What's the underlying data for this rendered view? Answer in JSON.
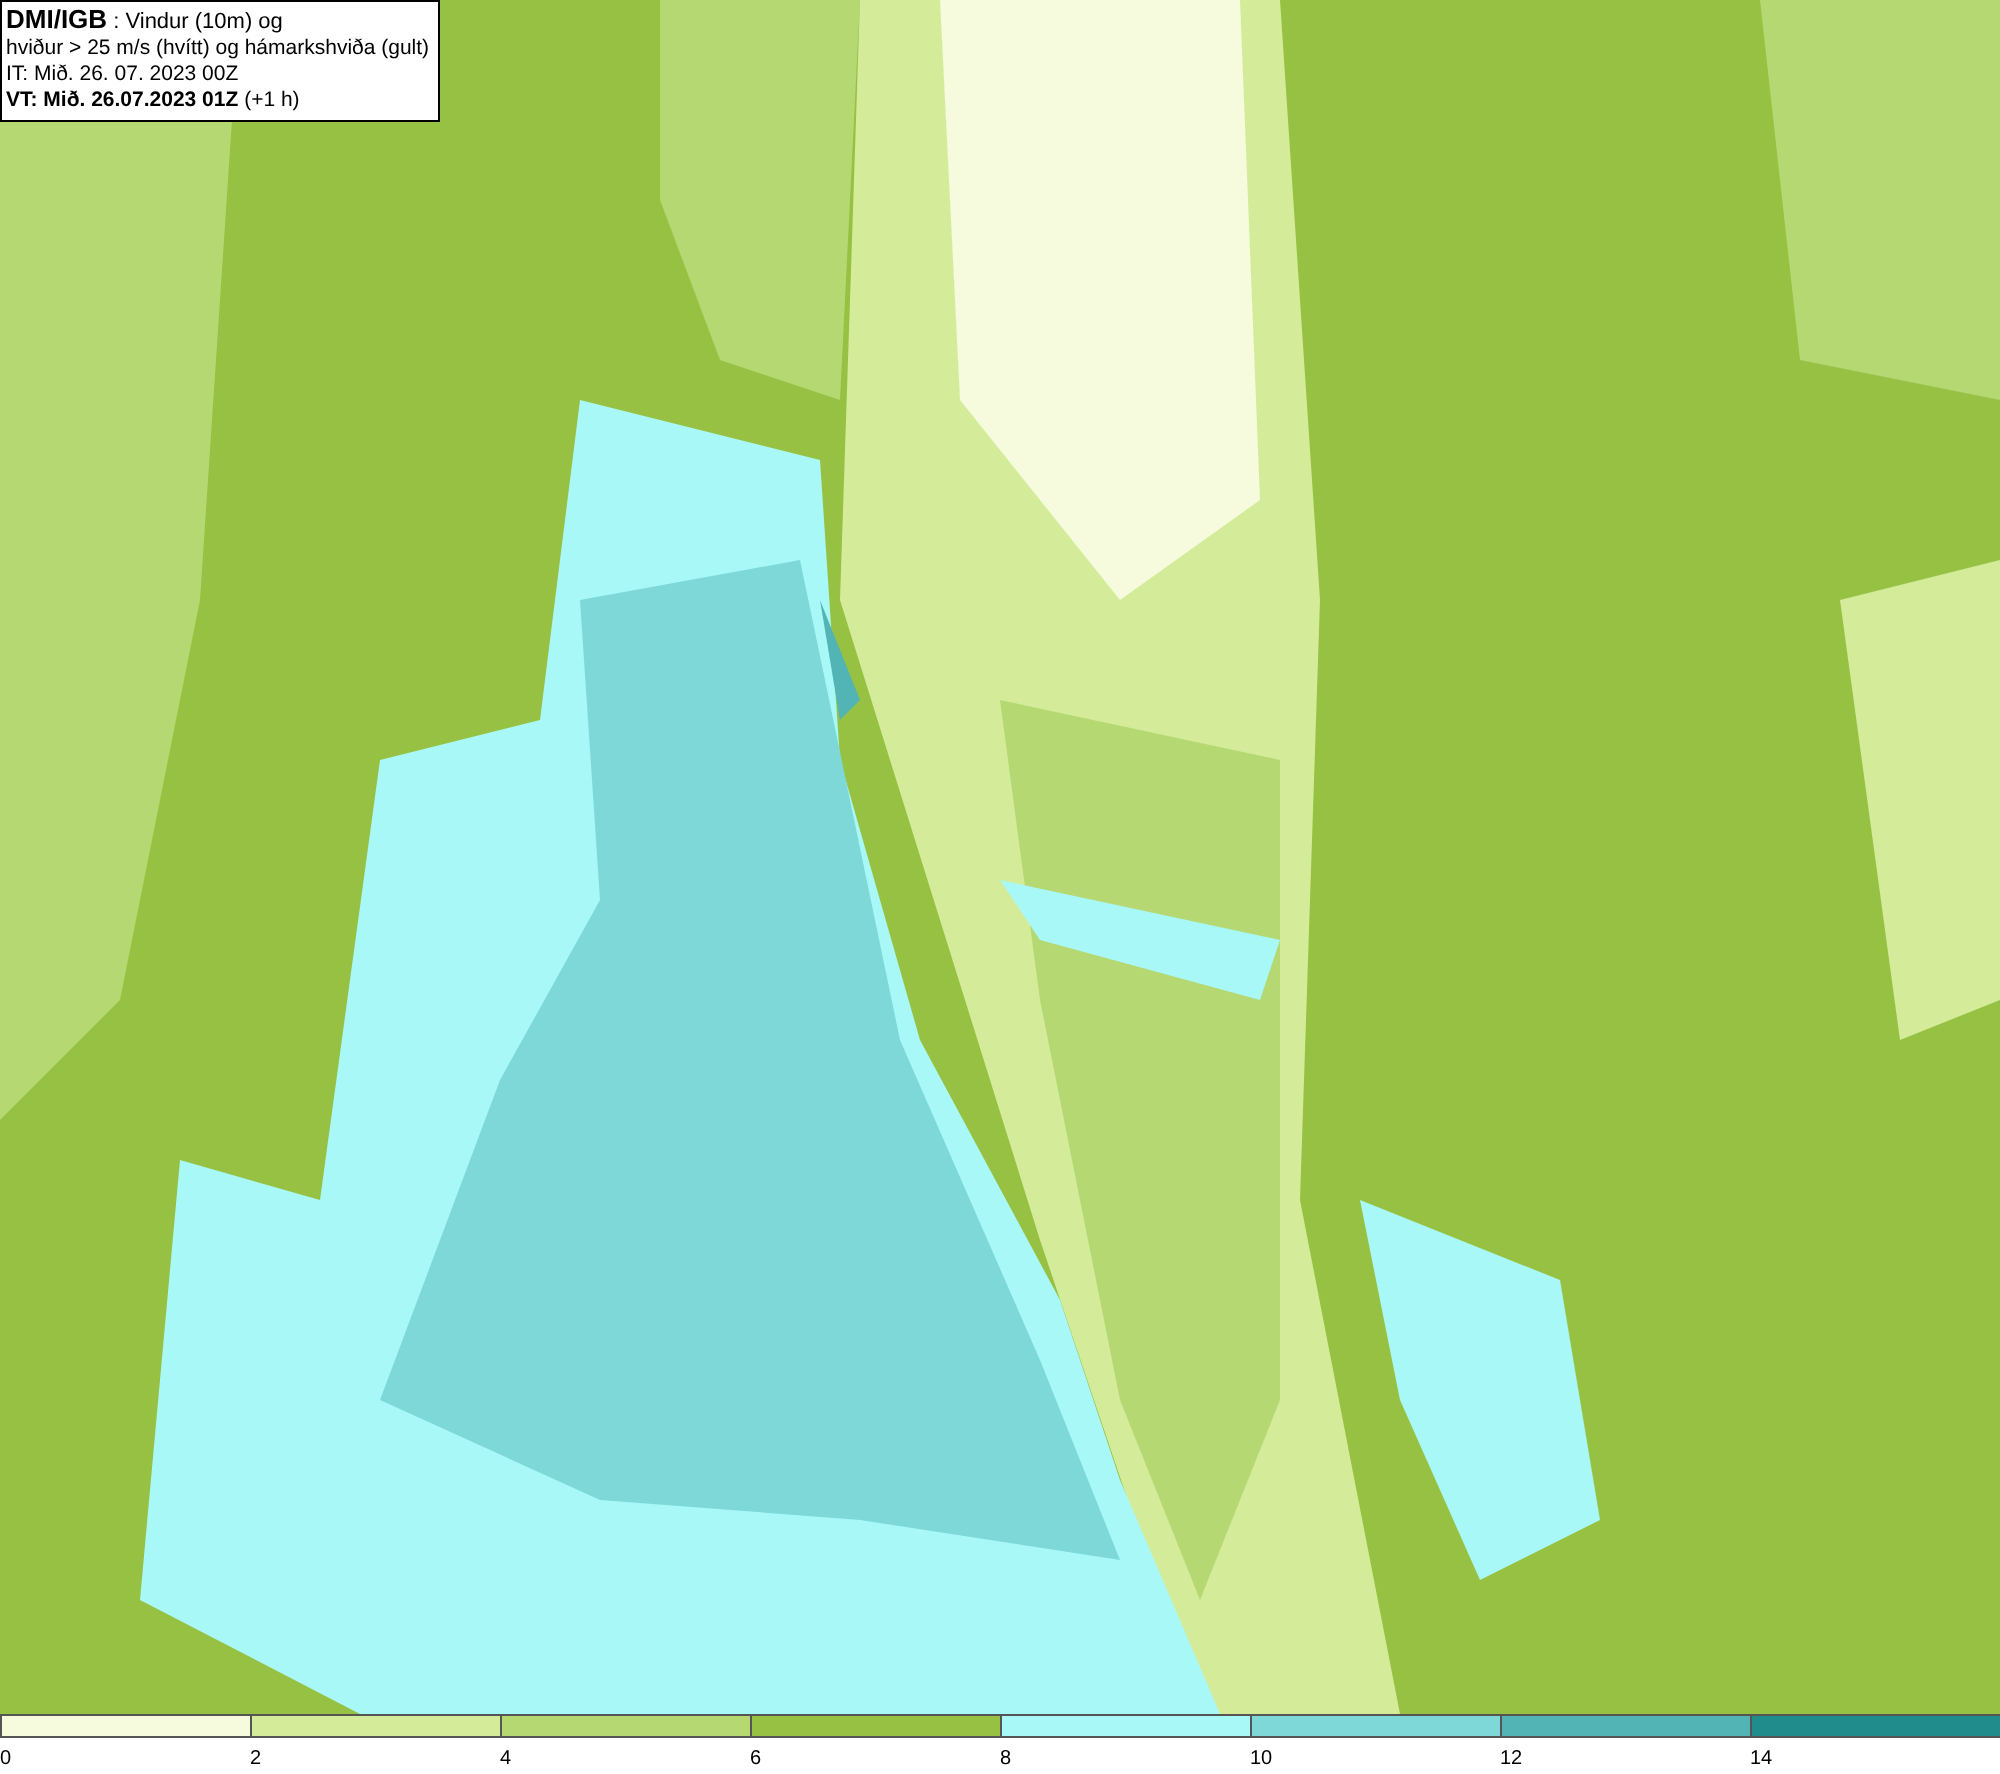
{
  "info_box": {
    "lines": [
      {
        "kind": "title",
        "text": "**DMI/IGB** : Vindur (10m) og"
      },
      {
        "kind": "plain",
        "text": "hviður > 25 m/s (hvítt) og hámarkshviða (gult)"
      },
      {
        "kind": "plain",
        "text": "IT: Mið. 26. 07. 2023 00Z"
      },
      {
        "kind": "plain",
        "text": "**VT: Mið. 26.07.2023 01Z** (+1 h)"
      }
    ]
  },
  "legend": {
    "bins": [
      {
        "color": "#f5fbdc"
      },
      {
        "color": "#d4ec9a"
      },
      {
        "color": "#b5d873"
      },
      {
        "color": "#97c143"
      },
      {
        "color": "#a8f8f8"
      },
      {
        "color": "#7fd8d8"
      },
      {
        "color": "#52b4b4"
      },
      {
        "color": "#218c8c"
      }
    ],
    "ticks": [
      "0",
      "2",
      "4",
      "6",
      "8",
      "10",
      "12",
      "14"
    ]
  }
}
